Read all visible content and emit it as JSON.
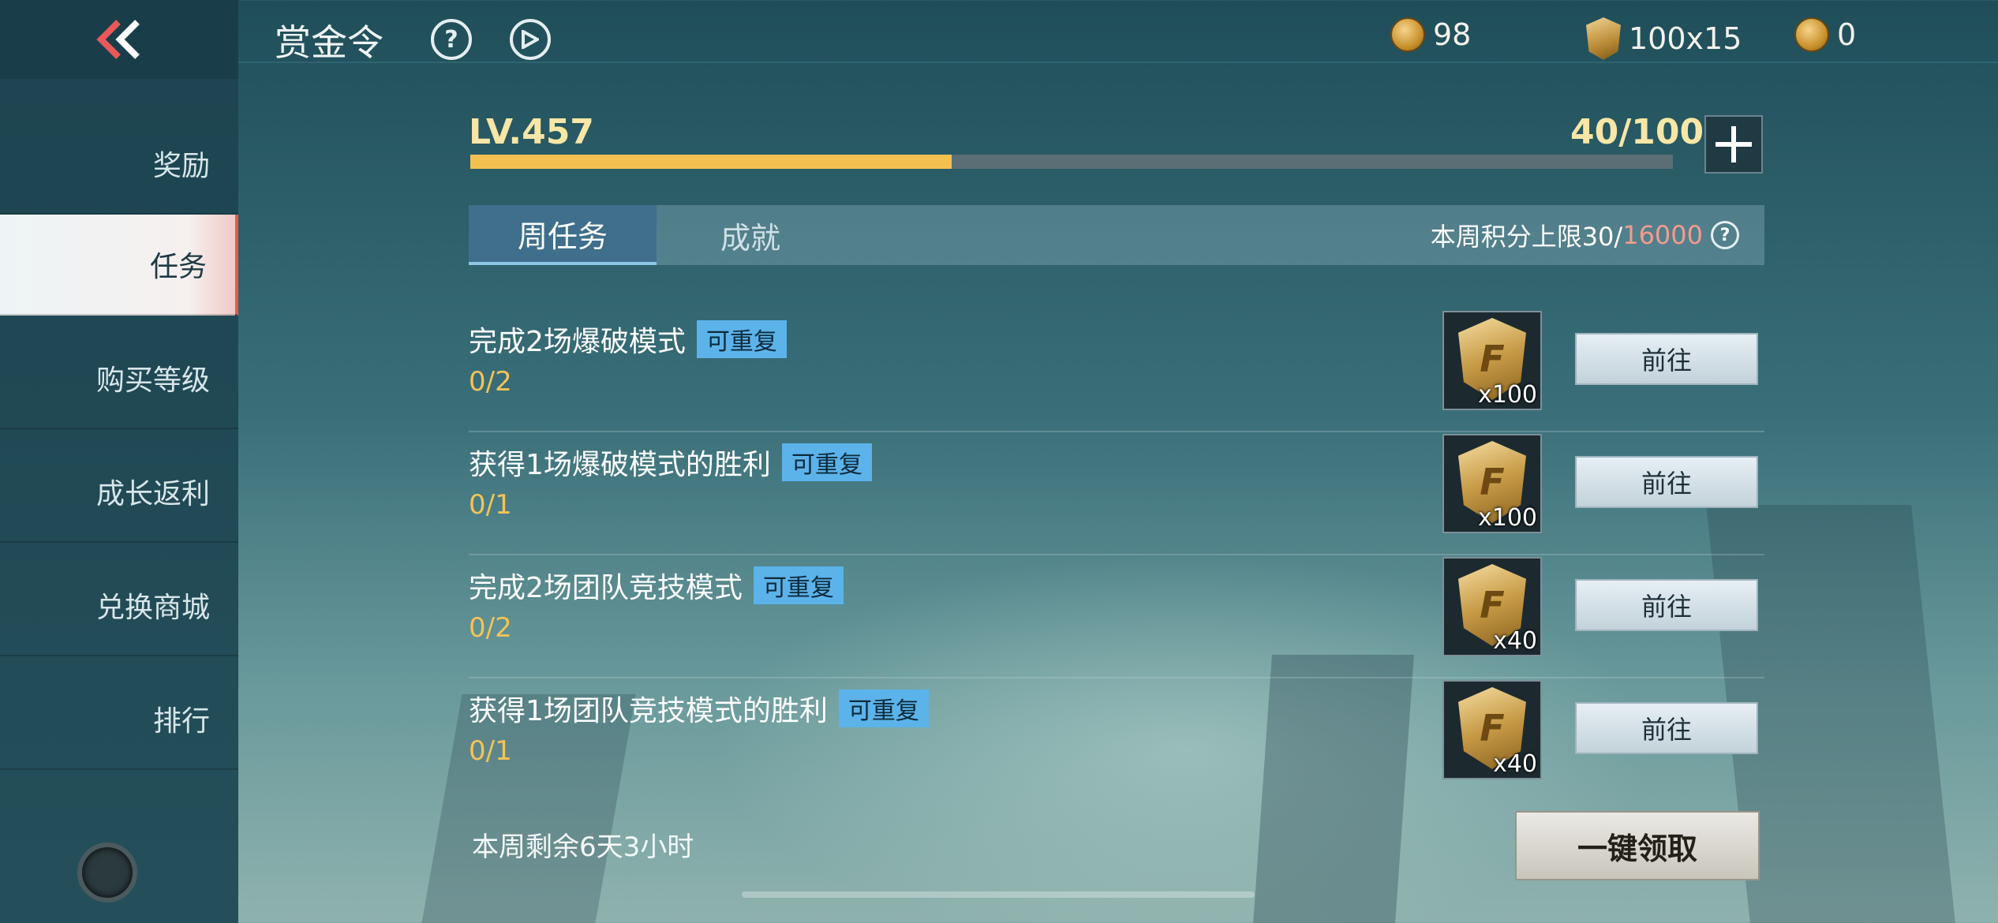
{
  "colors": {
    "accent_gold": "#f4c150",
    "active_tab": "#3f6f8c",
    "repeat_tag": "#5bb3ea",
    "quota_max": "#f39b8f",
    "active_indicator": "#e55b4f"
  },
  "header": {
    "title": "赏金令",
    "help_icon": "question-circle-icon",
    "video_icon": "play-circle-icon"
  },
  "currencies": [
    {
      "icon": "gold-coin-icon",
      "value": "98"
    },
    {
      "icon": "cf-badge-icon",
      "value": "100x15"
    },
    {
      "icon": "ticket-icon",
      "value": "0"
    }
  ],
  "sidebar": {
    "items": [
      {
        "label": "奖励",
        "active": false
      },
      {
        "label": "任务",
        "active": true
      },
      {
        "label": "购买等级",
        "active": false
      },
      {
        "label": "成长返利",
        "active": false
      },
      {
        "label": "兑换商城",
        "active": false
      },
      {
        "label": "排行",
        "active": false
      }
    ]
  },
  "level": {
    "label": "LV.457",
    "progress_text": "40/100",
    "progress_fraction": 0.4
  },
  "tabs": [
    {
      "label": "周任务",
      "active": true
    },
    {
      "label": "成就",
      "active": false
    }
  ],
  "quota": {
    "prefix": "本周积分上限30/",
    "max": "16000"
  },
  "tasks": [
    {
      "name": "完成2场爆破模式",
      "tag": "可重复",
      "progress": "0/2",
      "reward_count": "x100",
      "button": "前往"
    },
    {
      "name": "获得1场爆破模式的胜利",
      "tag": "可重复",
      "progress": "0/1",
      "reward_count": "x100",
      "button": "前往"
    },
    {
      "name": "完成2场团队竞技模式",
      "tag": "可重复",
      "progress": "0/2",
      "reward_count": "x40",
      "button": "前往"
    },
    {
      "name": "获得1场团队竞技模式的胜利",
      "tag": "可重复",
      "progress": "0/1",
      "reward_count": "x40",
      "button": "前往"
    }
  ],
  "footer": {
    "remaining": "本周剩余6天3小时",
    "claim_all": "一键领取"
  }
}
